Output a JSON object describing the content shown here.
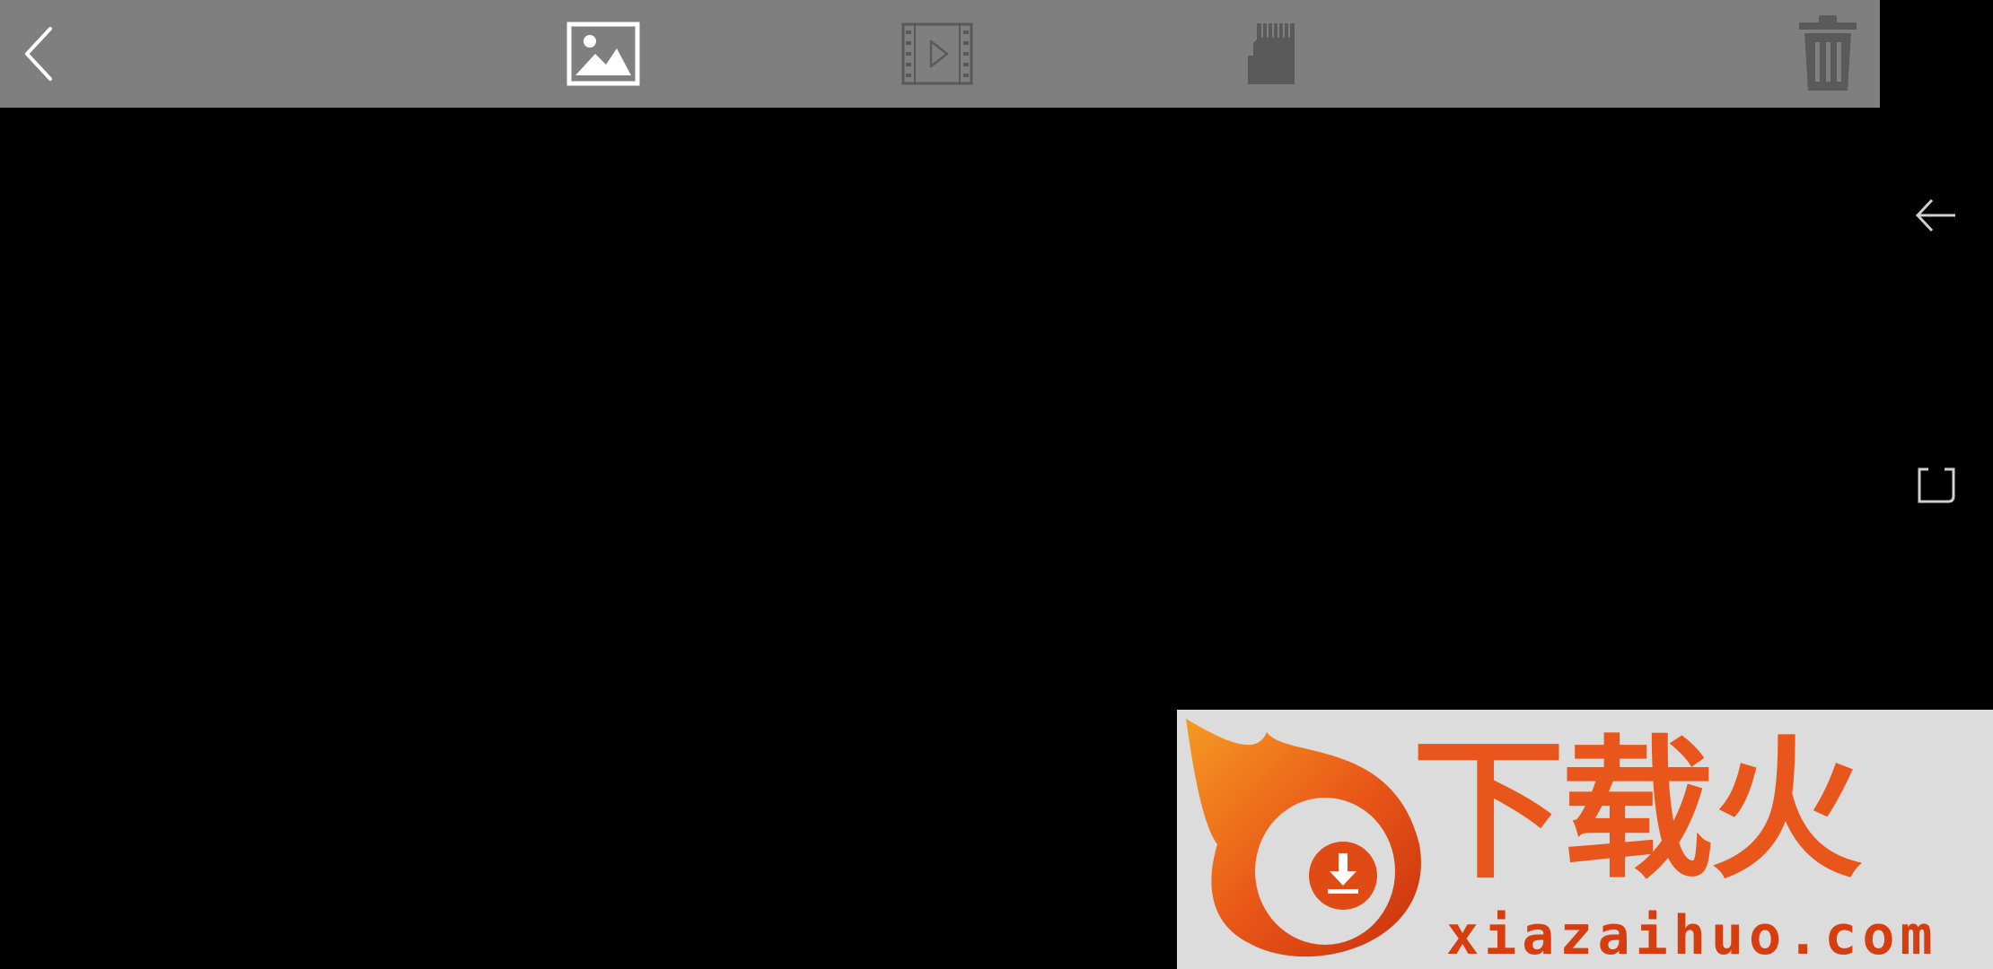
{
  "toolbar": {
    "back_icon": "chevron-left-icon",
    "tabs": [
      {
        "id": "photos",
        "icon": "image-icon",
        "selected": true
      },
      {
        "id": "videos",
        "icon": "film-play-icon",
        "selected": false
      },
      {
        "id": "sdcard",
        "icon": "sd-card-icon",
        "selected": false
      }
    ],
    "delete_icon": "trash-icon",
    "background_color": "#7f7f7f",
    "icon_color": "#5a5a5a",
    "selected_icon_color": "#ffffff"
  },
  "navigation_bar": {
    "buttons": [
      {
        "id": "back",
        "icon": "back-arrow-icon"
      },
      {
        "id": "recents",
        "icon": "recents-icon"
      },
      {
        "id": "home",
        "icon": "home-icon"
      }
    ]
  },
  "watermark": {
    "title": "下载火",
    "url": "xiazaihuo.com",
    "logo": "flame-download-logo",
    "colors": {
      "primary": "#e8561b",
      "dark": "#c8300d",
      "background": "#dcdcdc"
    }
  }
}
